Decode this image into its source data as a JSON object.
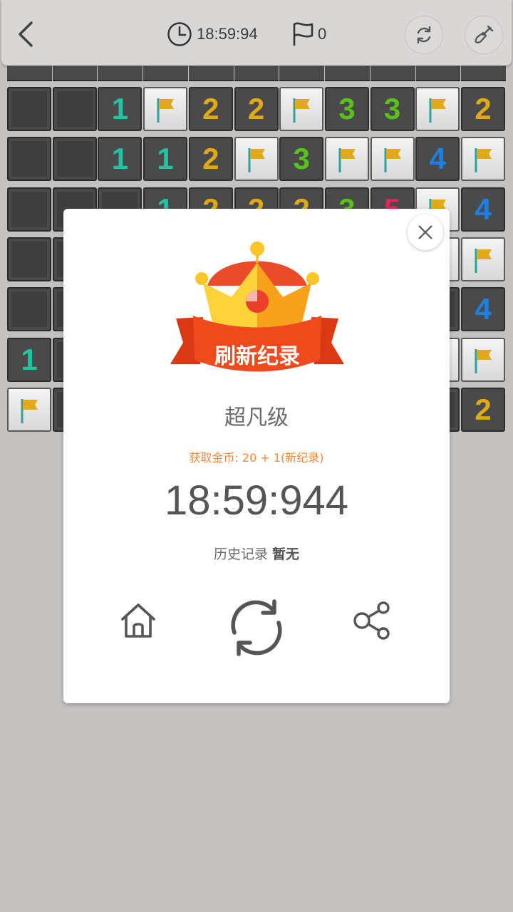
{
  "topbar": {
    "back_icon": "chevron-left-icon",
    "timer_icon": "clock-icon",
    "timer": "18:59:94",
    "flag_icon": "flag-outline-icon",
    "flag_count": "0",
    "restart_icon": "refresh-icon",
    "shovel_icon": "shovel-icon"
  },
  "board": {
    "rows": [
      [
        "U",
        "U",
        "1",
        "F",
        "2",
        "2",
        "F",
        "3",
        "3",
        "F",
        "2"
      ],
      [
        "U",
        "U",
        "1",
        "1",
        "2",
        "F",
        "3",
        "F",
        "F",
        "4",
        "F"
      ],
      [
        "U",
        "U",
        "U",
        "1",
        "2",
        "2",
        "2",
        "3",
        "5",
        "F",
        "4"
      ],
      [
        "U",
        "U",
        "U",
        "U",
        "U",
        "U",
        "U",
        "U",
        "U",
        "F",
        "F"
      ],
      [
        "U",
        "U",
        "U",
        "U",
        "U",
        "U",
        "U",
        "U",
        "U",
        "U",
        "4"
      ],
      [
        "1",
        "U",
        "U",
        "U",
        "U",
        "U",
        "U",
        "U",
        "U",
        "F",
        "F"
      ],
      [
        "F",
        "U",
        "U",
        "U",
        "U",
        "U",
        "U",
        "U",
        "U",
        "U",
        "2"
      ]
    ]
  },
  "dialog": {
    "banner": "刷新纪录",
    "level": "超凡级",
    "coins": "获取金币: 20 + 1(新纪录)",
    "time": "18:59:944",
    "history_label": "历史记录",
    "history_value": "暂无",
    "close_icon": "close-icon",
    "crown_icon": "crown-icon",
    "home_icon": "home-icon",
    "replay_icon": "replay-icon",
    "share_icon": "share-icon"
  },
  "colors": {
    "n1": "#1ec5a0",
    "n2": "#e0a915",
    "n3": "#57c21a",
    "n4": "#1e7fe0",
    "n5": "#e0245a",
    "coins_text": "#ef8a3d",
    "banner_red": "#e8401a",
    "crown_gold": "#fbb42a"
  }
}
